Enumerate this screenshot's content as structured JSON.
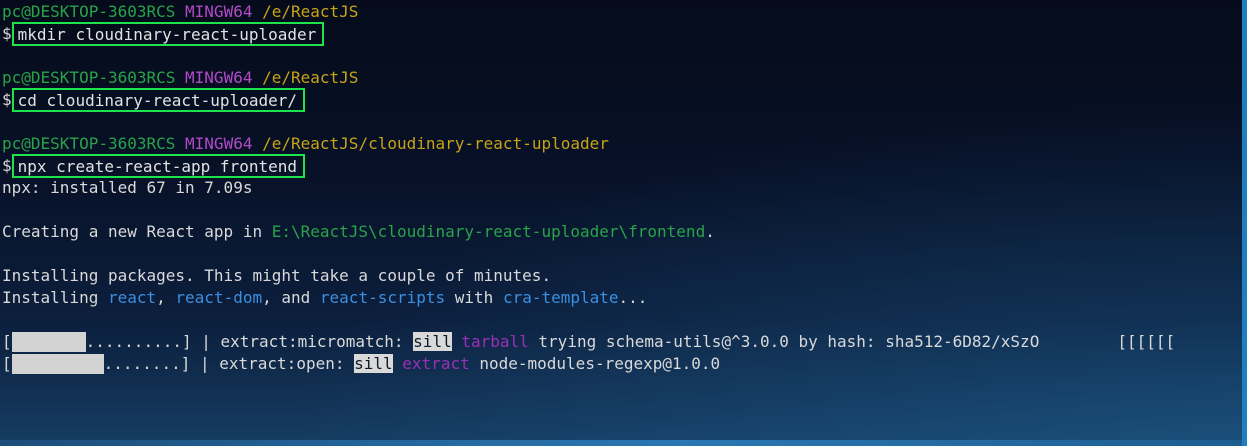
{
  "terminal": {
    "prompts": [
      {
        "user_host": "pc@DESKTOP-3603RCS",
        "shell": "MINGW64",
        "path": "/e/ReactJS",
        "symbol": "$",
        "command": "mkdir cloudinary-react-uploader"
      },
      {
        "user_host": "pc@DESKTOP-3603RCS",
        "shell": "MINGW64",
        "path": "/e/ReactJS",
        "symbol": "$",
        "command": "cd cloudinary-react-uploader/"
      },
      {
        "user_host": "pc@DESKTOP-3603RCS",
        "shell": "MINGW64",
        "path": "/e/ReactJS/cloudinary-react-uploader",
        "symbol": "$",
        "command": "npx create-react-app frontend"
      }
    ],
    "output": {
      "installed": "npx: installed 67 in 7.09s",
      "creating_prefix": "Creating a new React app in ",
      "creating_path": "E:\\ReactJS\\cloudinary-react-uploader\\frontend",
      "creating_suffix": ".",
      "installing_packages": "Installing packages. This might take a couple of minutes.",
      "installing_prefix": "Installing ",
      "pkg_react": "react",
      "sep1": ", ",
      "pkg_react_dom": "react-dom",
      "sep2": ", and ",
      "pkg_react_scripts": "react-scripts",
      "with_text": " with ",
      "template": "cra-template",
      "ellipsis": "..."
    },
    "progress": [
      {
        "bracket_open": "[",
        "dots": "..........",
        "bracket_close": "]",
        "pipe": " | ",
        "step": "extract:micromatch: ",
        "level": "sill",
        "action": "tarball",
        "message": " trying schema-utils@^3.0.0 by hash: sha512-6D82/xSzO",
        "trail": "[[[[[["
      },
      {
        "bracket_open": "[",
        "dots": "........",
        "bracket_close": "]",
        "pipe": " | ",
        "step": "extract:open: ",
        "level": "sill",
        "action": "extract",
        "message": " node-modules-regexp@1.0.0"
      }
    ]
  },
  "colors": {
    "prompt_green": "#29a349",
    "shell_magenta": "#b249c7",
    "path_yellow": "#c7a318",
    "package_blue": "#3b8fe0",
    "highlight_box": "#1ee34c"
  }
}
